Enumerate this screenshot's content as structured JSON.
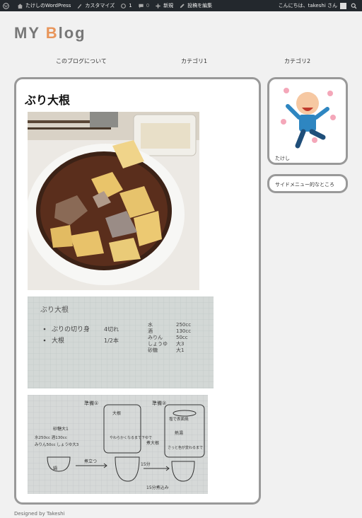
{
  "adminbar": {
    "site_name": "たけしのWordPress",
    "customize": "カスタマイズ",
    "updates_count": "1",
    "comments_count": "0",
    "new_label": "新規",
    "edit_post": "投稿を編集",
    "greeting": "こんにちは、takeshi さん"
  },
  "header": {
    "title_prefix": "MY ",
    "title_accent": "B",
    "title_suffix": "log"
  },
  "nav": {
    "items": [
      "このブログについて",
      "カテゴリ1",
      "カテゴリ2"
    ]
  },
  "post": {
    "title": "ぶり大根"
  },
  "recipe1": {
    "heading": "ぶり大根",
    "ing1": "ぶりの切り身",
    "ing1_qty": "4切れ",
    "ing2": "大根",
    "ing2_qty": "1/2本",
    "seasonings": [
      "水",
      "酒",
      "みりん",
      "しょうゆ",
      "砂糖"
    ],
    "seasoning_qty": [
      "250cc",
      "130cc",
      "50cc",
      "大3",
      "大1"
    ]
  },
  "recipe2": {
    "prep1": "準備①",
    "prep2": "準備②",
    "mix1": "砂糖大1",
    "mix2": "水250cc 酒130cc",
    "mix3": "みりん50cc しょうゆ大3",
    "pot_label": "鍋",
    "step_boil": "煮立つ",
    "time": "15分",
    "daikon": "大根",
    "soft": "やわらかくなるまで下ゆで",
    "add_daikon": "煮大根",
    "fish_note": "塩で表面焼",
    "hot_water": "熱湯",
    "surface": "さっと色が変わるまで",
    "simmer": "15分煮込み"
  },
  "sidebar": {
    "profile_name": "たけし",
    "menu_label": "サイドメニュー的なところ"
  },
  "footer": {
    "credit": "Designed by Takeshi"
  },
  "colors": {
    "accent": "#e8955a",
    "card_border": "#999999",
    "adminbar_bg": "#23282d"
  }
}
